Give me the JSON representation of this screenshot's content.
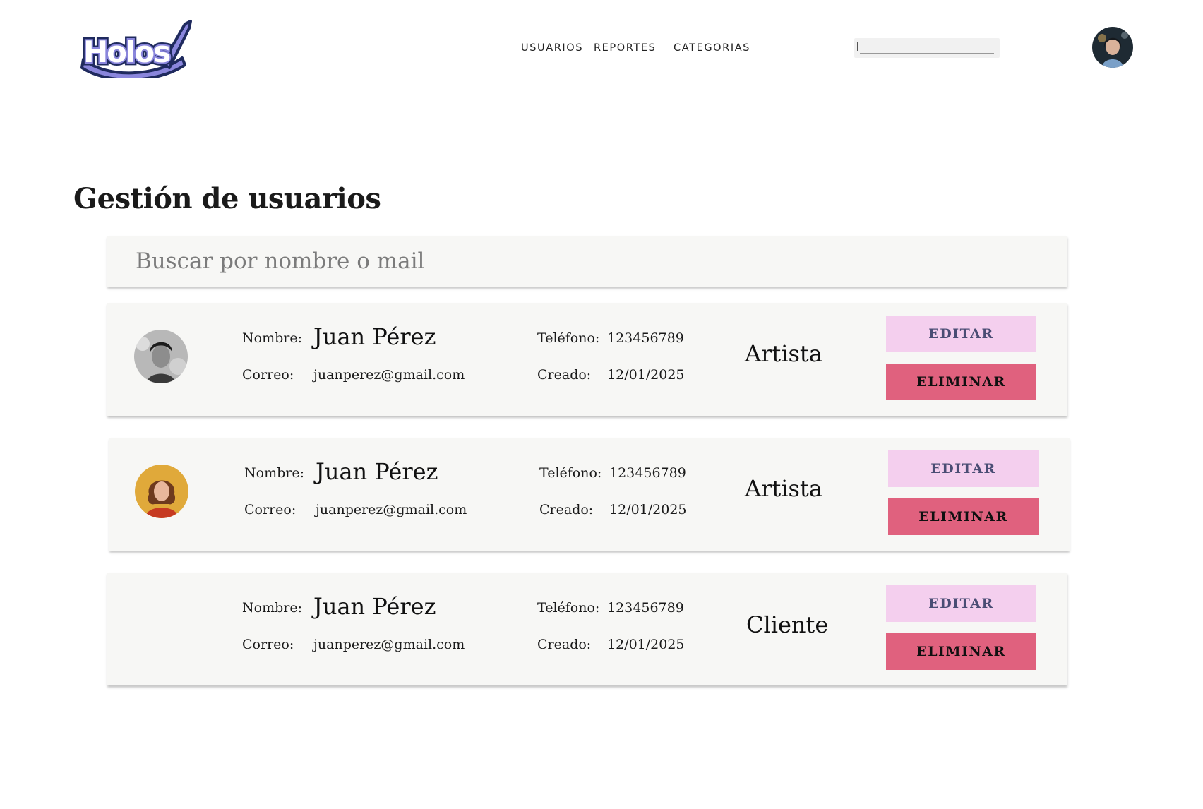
{
  "header": {
    "logo_text": "Holos",
    "nav": [
      "USUARIOS",
      "REPORTES",
      "CATEGORIAS"
    ],
    "search_value": ""
  },
  "page": {
    "title": "Gestión de usuarios",
    "search_placeholder": "Buscar por nombre o mail"
  },
  "labels": {
    "nombre": "Nombre:",
    "correo": "Correo:",
    "telefono": "Teléfono:",
    "creado": "Creado:",
    "edit": "EDITAR",
    "delete": "ELIMINAR"
  },
  "users": [
    {
      "name": "Juan Pérez",
      "email": "juanperez@gmail.com",
      "phone": "123456789",
      "created": "12/01/2025",
      "role": "Artista",
      "avatar": "man-portrait"
    },
    {
      "name": "Juan Pérez",
      "email": "juanperez@gmail.com",
      "phone": "123456789",
      "created": "12/01/2025",
      "role": "Artista",
      "avatar": "woman-portrait"
    },
    {
      "name": "Juan Pérez",
      "email": "juanperez@gmail.com",
      "phone": "123456789",
      "created": "12/01/2025",
      "role": "Cliente",
      "avatar": ""
    }
  ],
  "colors": {
    "edit_button": "#f4cfee",
    "edit_text": "#4a4d74",
    "delete_button": "#e0617e",
    "card_bg": "#f7f7f5",
    "logo_fill": "#8a86dc",
    "logo_outline": "#1f2a5e"
  }
}
